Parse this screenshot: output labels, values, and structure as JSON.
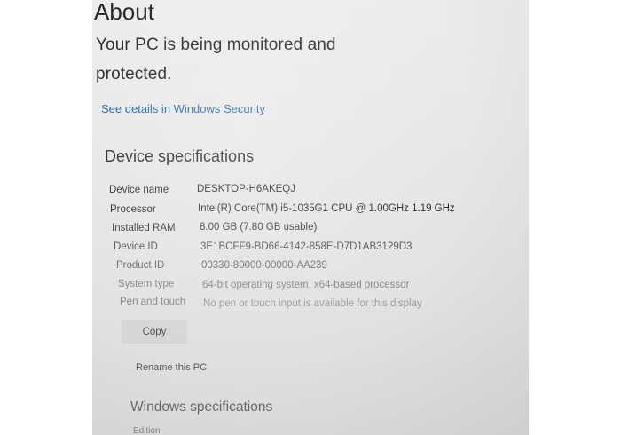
{
  "about": {
    "title": "About",
    "status_line1": "Your PC is being monitored and",
    "status_line2": "protected.",
    "security_link": "See details in Windows Security"
  },
  "device_specs": {
    "heading": "Device specifications",
    "rows": [
      {
        "label": "Device name",
        "value": "DESKTOP-H6AKEQJ"
      },
      {
        "label": "Processor",
        "value": "Intel(R) Core(TM) i5-1035G1 CPU @ 1.00GHz   1.19 GHz"
      },
      {
        "label": "Installed RAM",
        "value": "8.00 GB (7.80 GB usable)"
      },
      {
        "label": "Device ID",
        "value": "3E1BCFF9-BD66-4142-858E-D7D1AB3129D3"
      },
      {
        "label": "Product ID",
        "value": "00330-80000-00000-AA239"
      },
      {
        "label": "System type",
        "value": "64-bit operating system, x64-based processor"
      },
      {
        "label": "Pen and touch",
        "value": "No pen or touch input is available for this display"
      }
    ],
    "copy_button": "Copy",
    "rename_link": "Rename this PC"
  },
  "windows_specs": {
    "heading": "Windows specifications",
    "first_label": "Edition"
  },
  "colors": {
    "link": "#1d5fb8",
    "background": "#e6e6e6",
    "text": "#222222"
  }
}
